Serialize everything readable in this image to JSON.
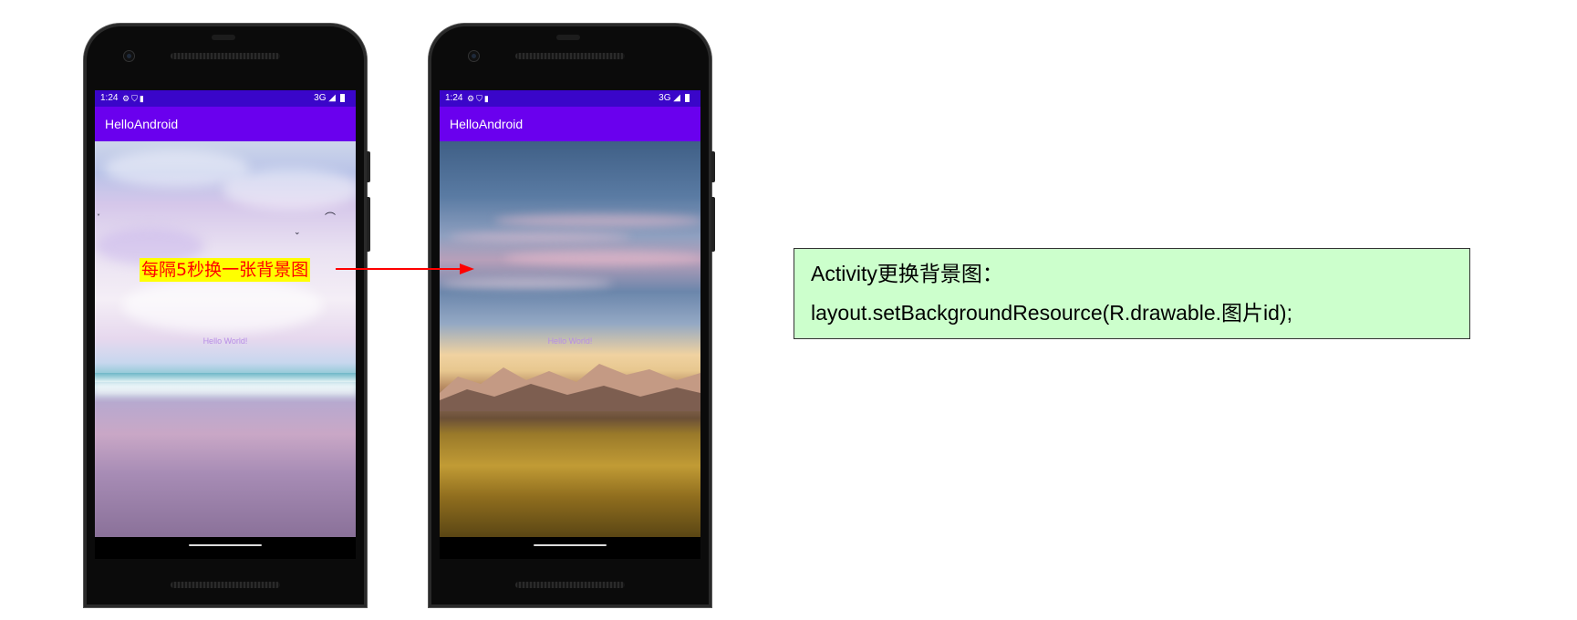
{
  "phones": [
    {
      "status_time": "1:24",
      "status_network": "3G",
      "app_title": "HelloAndroid",
      "hello_text": "Hello World!"
    },
    {
      "status_time": "1:24",
      "status_network": "3G",
      "app_title": "HelloAndroid",
      "hello_text": "Hello World!"
    }
  ],
  "annotation": {
    "label": "每隔5秒换一张背景图",
    "label_color": "#ff0000",
    "highlight_color": "#ffff00"
  },
  "code_box": {
    "title": "Activity更换背景图：",
    "code": "layout.setBackgroundResource(R.drawable.图片id);",
    "background_color": "#ccffcc"
  },
  "colors": {
    "status_bar": "#3a06c9",
    "app_bar": "#6a00ee",
    "arrow": "#ff0000"
  }
}
